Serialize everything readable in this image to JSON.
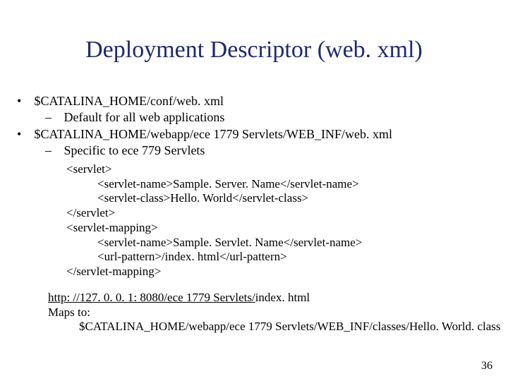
{
  "title": "Deployment Descriptor (web. xml)",
  "bullets": {
    "b1": {
      "text": "$CATALINA_HOME/conf/web. xml",
      "sub": "Default for all web applications"
    },
    "b2": {
      "text": "$CATALINA_HOME/webapp/ece 1779 Servlets/WEB_INF/web. xml",
      "sub": "Specific to ece 779 Servlets"
    }
  },
  "code": {
    "l1": "<servlet>",
    "l2": "<servlet-name>Sample. Server. Name</servlet-name>",
    "l3": "<servlet-class>Hello. World</servlet-class>",
    "l4": "</servlet>",
    "l5": "<servlet-mapping>",
    "l6": "<servlet-name>Sample. Servlet. Name</servlet-name>",
    "l7": "<url-pattern>/index. html</url-pattern>",
    "l8": "</servlet-mapping>"
  },
  "tail": {
    "url_underlined": "http: //127. 0. 0. 1: 8080/ece 1779 Servlets/",
    "url_rest": "index. html",
    "maps_label": "Maps to:",
    "maps_value": "$CATALINA_HOME/webapp/ece 1779 Servlets/WEB_INF/classes/Hello. World. class"
  },
  "page_number": "36"
}
